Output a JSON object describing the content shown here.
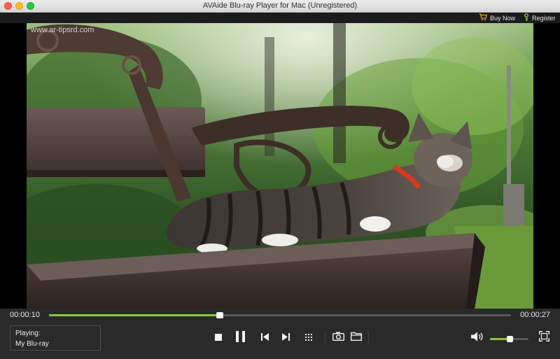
{
  "window": {
    "title": "AVAide Blu-ray Player for Mac (Unregistered)"
  },
  "topbar": {
    "buy_now_label": "Buy Now",
    "register_label": "Register",
    "cart_icon": "cart-icon",
    "key_icon": "key-icon"
  },
  "video": {
    "watermark": "www.ar-tipsrd.com",
    "scene": "tabby cat lying on park bench"
  },
  "playback": {
    "current_time": "00:00:10",
    "total_time": "00:00:27",
    "progress_fraction": 0.37,
    "volume_fraction": 0.5
  },
  "now_playing": {
    "label": "Playing:",
    "title": "My Blu-ray"
  },
  "colors": {
    "accent": "#8cc63f",
    "control_bg": "#2a2a2a",
    "titlebar_bg": "#e3e3e3"
  },
  "controls": {
    "stop_icon": "stop-icon",
    "pause_icon": "pause-icon",
    "previous_icon": "skip-previous-icon",
    "next_icon": "skip-next-icon",
    "menu_icon": "grid-menu-icon",
    "snapshot_icon": "camera-icon",
    "folder_icon": "folder-icon",
    "volume_icon": "speaker-icon",
    "fullscreen_icon": "fullscreen-icon"
  }
}
